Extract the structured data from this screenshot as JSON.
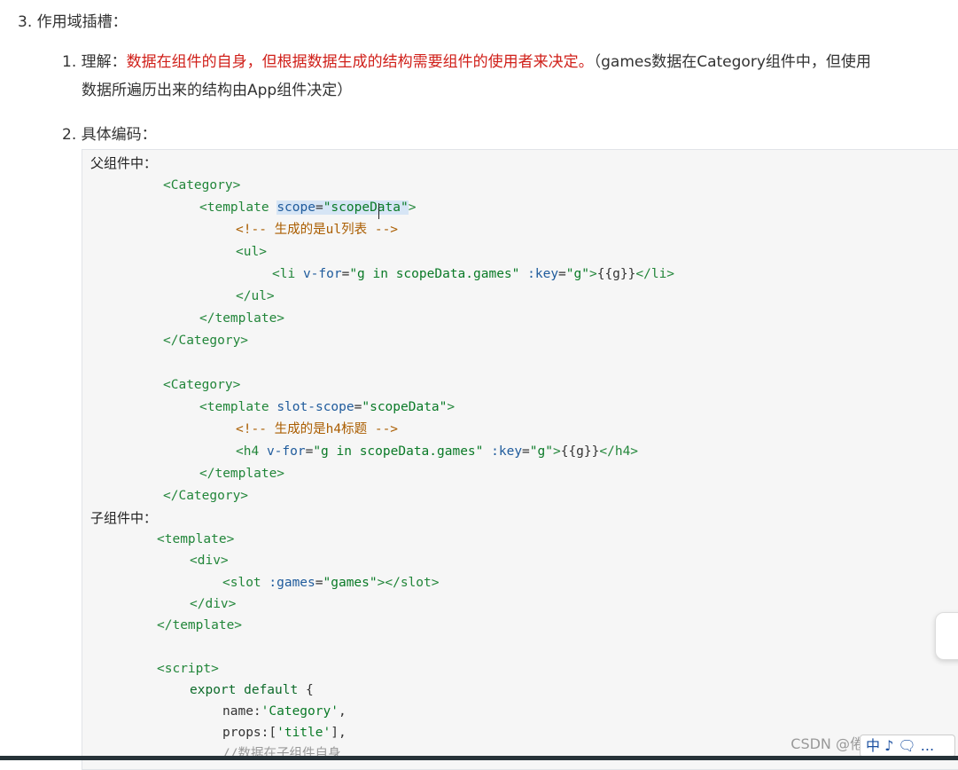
{
  "section": {
    "title": "3. 作用域插槽："
  },
  "item1": {
    "num": "1.",
    "prefix": "理解：",
    "highlight": "数据在组件的自身，但根据数据生成的结构需要组件的使用者来决定。",
    "rest_line1": "（games数据在Category组件中，但使用",
    "rest_line2": "数据所遍历出来的结构由App组件决定）"
  },
  "item2": {
    "num": "2.",
    "label": "具体编码："
  },
  "code": {
    "parent_label": "父组件中：",
    "child_label": "子组件中：",
    "comment1": "<!-- 生成的是ul列表 -->",
    "comment2": "<!-- 生成的是h4标题 -->",
    "script_comment": "//数据在子组件自身"
  },
  "watermark": "CSDN @倦鸟叫了一整天",
  "ime": "中 ♪ 🗨 ..."
}
